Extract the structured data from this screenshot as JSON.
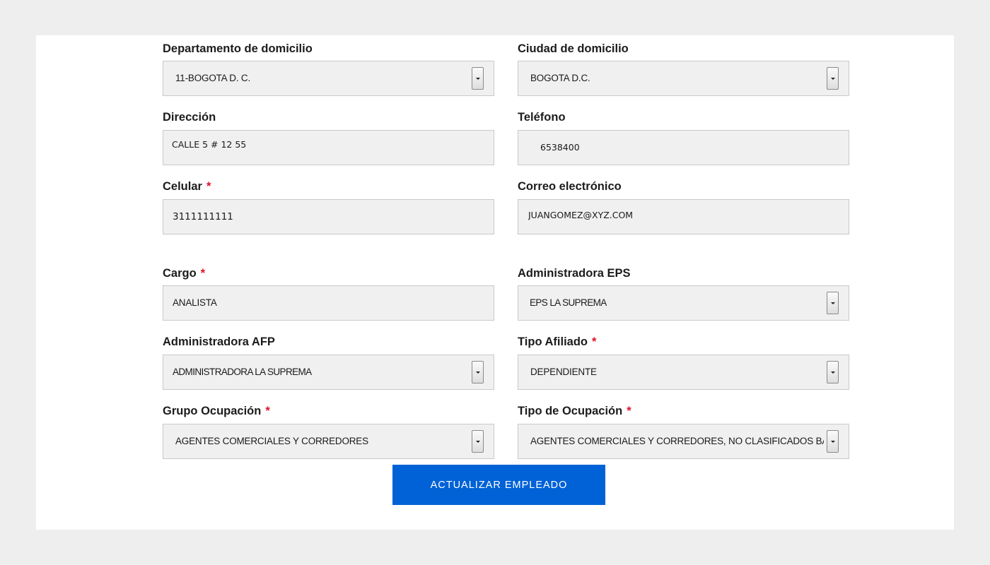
{
  "form": {
    "departamento": {
      "label": "Departamento de domicilio",
      "required": false,
      "value": "11-BOGOTA D. C."
    },
    "ciudad": {
      "label": "Ciudad de domicilio",
      "required": false,
      "value": "BOGOTA D.C."
    },
    "direccion": {
      "label": "Dirección",
      "required": false,
      "value": "CALLE 5 # 12  55"
    },
    "telefono": {
      "label": "Teléfono",
      "required": false,
      "value": "6538400"
    },
    "celular": {
      "label": "Celular",
      "required": true,
      "value": "3111111111"
    },
    "correo": {
      "label": "Correo electrónico",
      "required": false,
      "value": "JUANGOMEZ@XYZ.COM"
    },
    "cargo": {
      "label": "Cargo",
      "required": true,
      "value": "ANALISTA"
    },
    "eps": {
      "label": "Administradora EPS",
      "required": false,
      "value": "EPS LA SUPREMA"
    },
    "afp": {
      "label": "Administradora AFP",
      "required": false,
      "value": "ADMINISTRADORA LA SUPREMA"
    },
    "tipo_afiliado": {
      "label": "Tipo Afiliado",
      "required": true,
      "value": "DEPENDIENTE"
    },
    "grupo_ocupacion": {
      "label": "Grupo Ocupación",
      "required": true,
      "value": "AGENTES COMERCIALES Y CORREDORES"
    },
    "tipo_ocupacion": {
      "label": "Tipo de Ocupación",
      "required": true,
      "value": "AGENTES COMERCIALES Y CORREDORES, NO CLASIFICADOS BAJO OTROS EPIGRAFES"
    },
    "required_marker": "*",
    "submit_label": "ACTUALIZAR EMPLEADO"
  },
  "colors": {
    "page_background": "#eeeeee",
    "panel_background": "#ffffff",
    "field_background": "#f0f0f0",
    "required_marker": "#e0102a",
    "submit_background": "#0062d6"
  },
  "icons": {
    "select_toggle": "chevron-down-icon"
  }
}
